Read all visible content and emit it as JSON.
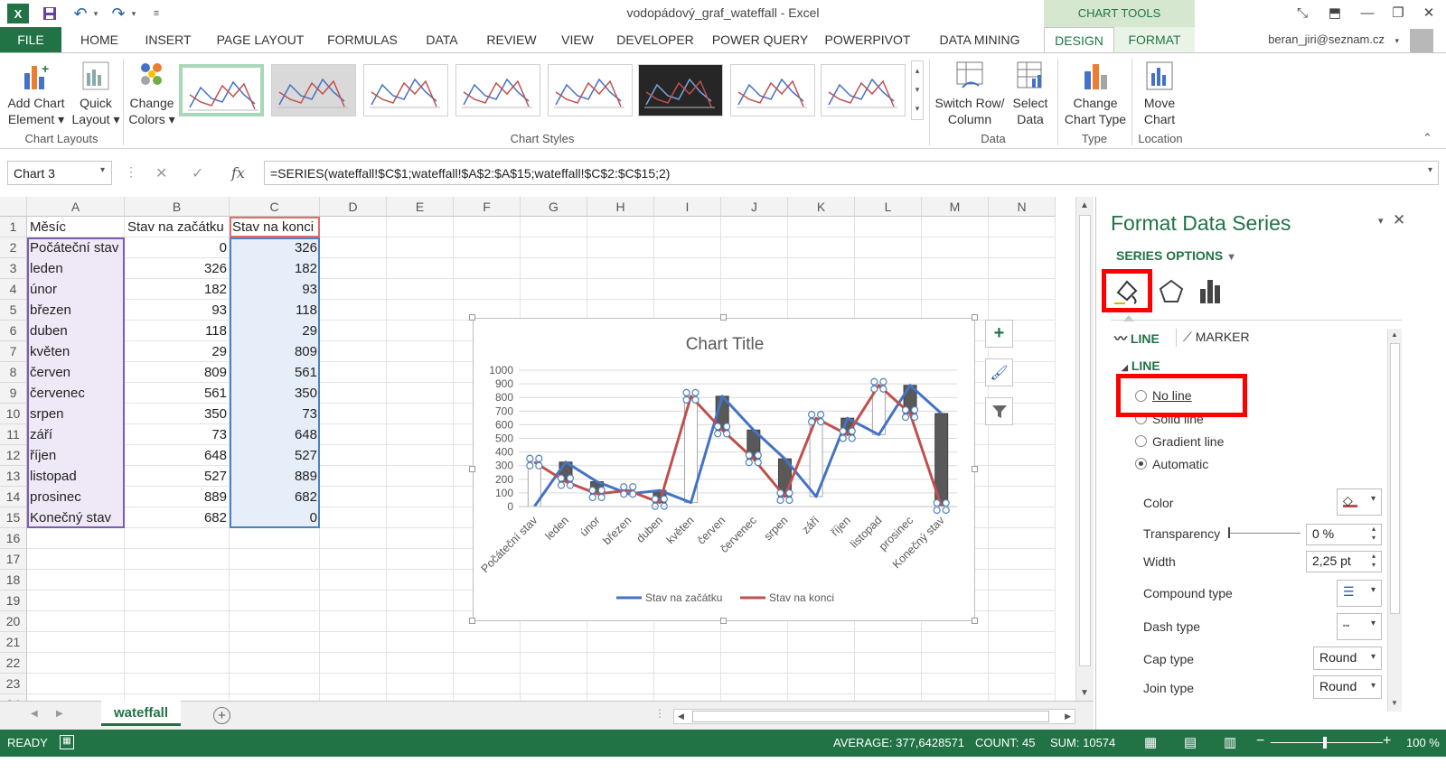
{
  "window": {
    "title": "vodopádový_graf_wateffall - Excel",
    "chart_tools": "CHART TOOLS"
  },
  "tabs": {
    "file": "FILE",
    "home": "HOME",
    "insert": "INSERT",
    "page_layout": "PAGE LAYOUT",
    "formulas": "FORMULAS",
    "data": "DATA",
    "review": "REVIEW",
    "view": "VIEW",
    "developer": "DEVELOPER",
    "power_query": "POWER QUERY",
    "powerpivot": "POWERPIVOT",
    "data_mining": "DATA MINING",
    "design": "DESIGN",
    "format": "FORMAT"
  },
  "user": "beran_jiri@seznam.cz",
  "ribbon": {
    "add_chart_element": [
      "Add Chart",
      "Element ▾"
    ],
    "quick_layout": [
      "Quick",
      "Layout ▾"
    ],
    "change_colors": [
      "Change",
      "Colors ▾"
    ],
    "switch_row_column": [
      "Switch Row/",
      "Column"
    ],
    "select_data": [
      "Select",
      "Data"
    ],
    "change_chart_type": [
      "Change",
      "Chart Type"
    ],
    "move_chart": [
      "Move",
      "Chart"
    ],
    "groups": {
      "chart_layouts": "Chart Layouts",
      "chart_styles": "Chart Styles",
      "data": "Data",
      "type": "Type",
      "location": "Location"
    }
  },
  "formula_bar": {
    "name_box": "Chart 3",
    "formula": "=SERIES(wateffall!$C$1;wateffall!$A$2:$A$15;wateffall!$C$2:$C$15;2)"
  },
  "columns": [
    "A",
    "B",
    "C",
    "D",
    "E",
    "F",
    "G",
    "H",
    "I",
    "J",
    "K",
    "L",
    "M",
    "N"
  ],
  "rows": [
    "1",
    "2",
    "3",
    "4",
    "5",
    "6",
    "7",
    "8",
    "9",
    "10",
    "11",
    "12",
    "13",
    "14",
    "15",
    "16",
    "17",
    "18",
    "19",
    "20",
    "21",
    "22",
    "23",
    "24"
  ],
  "table": {
    "headers": [
      "Měsíc",
      "Stav na začátku",
      "Stav na konci"
    ],
    "rows": [
      [
        "Počáteční stav",
        "0",
        "326"
      ],
      [
        "leden",
        "326",
        "182"
      ],
      [
        "únor",
        "182",
        "93"
      ],
      [
        "březen",
        "93",
        "118"
      ],
      [
        "duben",
        "118",
        "29"
      ],
      [
        "květen",
        "29",
        "809"
      ],
      [
        "červen",
        "809",
        "561"
      ],
      [
        "červenec",
        "561",
        "350"
      ],
      [
        "srpen",
        "350",
        "73"
      ],
      [
        "září",
        "73",
        "648"
      ],
      [
        "říjen",
        "648",
        "527"
      ],
      [
        "listopad",
        "527",
        "889"
      ],
      [
        "prosinec",
        "889",
        "682"
      ],
      [
        "Konečný stav",
        "682",
        "0"
      ]
    ]
  },
  "chart_data": {
    "type": "line",
    "title": "Chart Title",
    "categories": [
      "Počáteční stav",
      "leden",
      "únor",
      "březen",
      "duben",
      "květen",
      "červen",
      "červenec",
      "srpen",
      "září",
      "říjen",
      "listopad",
      "prosinec",
      "Konečný stav"
    ],
    "series": [
      {
        "name": "Stav na začátku",
        "color": "#4472c4",
        "values": [
          0,
          326,
          182,
          93,
          118,
          29,
          809,
          561,
          350,
          73,
          648,
          527,
          889,
          682
        ]
      },
      {
        "name": "Stav na konci",
        "color": "#c0504d",
        "values": [
          326,
          182,
          93,
          118,
          29,
          809,
          561,
          350,
          73,
          648,
          527,
          889,
          682,
          0
        ]
      }
    ],
    "ylim": [
      0,
      1000
    ],
    "yticks": [
      "0",
      "100",
      "200",
      "300",
      "400",
      "500",
      "600",
      "700",
      "800",
      "900",
      "1000"
    ],
    "grid": true,
    "legend": "bottom",
    "up_bar_color": "#ffffff",
    "down_bar_color": "#595959"
  },
  "pane": {
    "title": "Format Data Series",
    "series_options": "SERIES OPTIONS",
    "tab_line": "LINE",
    "tab_marker": "MARKER",
    "section": "LINE",
    "radios": [
      "No line",
      "Solid line",
      "Gradient line",
      "Automatic"
    ],
    "color_label": "Color",
    "transparency_label": "Transparency",
    "transparency_value": "0 %",
    "width_label": "Width",
    "width_value": "2,25 pt",
    "compound_label": "Compound type",
    "dash_label": "Dash type",
    "cap_label": "Cap type",
    "cap_value": "Round",
    "join_label": "Join type",
    "join_value": "Round",
    "highlight_color": "#ff0000"
  },
  "sheet_tab": "wateffall",
  "status": {
    "ready": "READY",
    "average": "AVERAGE: 377,6428571",
    "count": "COUNT: 45",
    "sum": "SUM: 10574",
    "zoom": "100 %"
  }
}
